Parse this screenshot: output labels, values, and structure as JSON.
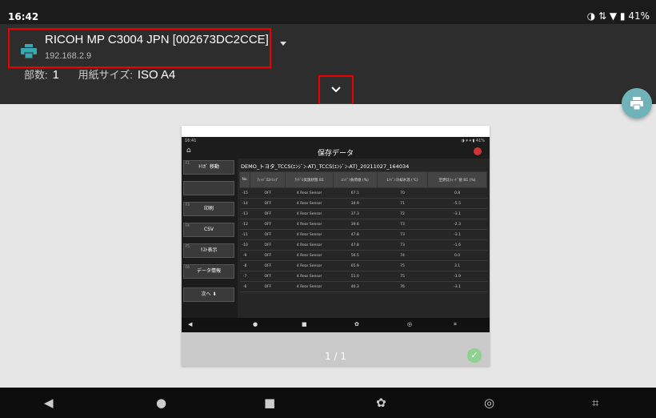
{
  "status": {
    "time": "16:42",
    "indicators": "◑ ⇅ ▼ ▮",
    "battery": "41%"
  },
  "printer": {
    "name": "RICOH MP C3004 JPN [002673DC2CCE]",
    "ip": "192.168.2.9"
  },
  "settings": {
    "copies_label": "部数:",
    "copies_value": "1",
    "paper_label": "用紙サイズ:",
    "paper_value": "ISO A4"
  },
  "preview": {
    "status_time": "16:41",
    "status_right": "◑ ▾ ▾ ▮ 41%",
    "title": "保存データ",
    "file_name": "DEMO_トヨタ_TCCS(ｴﾝｼﾞﾝ-AT)_TCCS(ｴﾝｼﾞﾝ-AT)_20211027_164034",
    "side_buttons": [
      {
        "fkey": "F1",
        "label": "ﾄﾘｶﾞ 移動"
      },
      {
        "fkey": "",
        "label": ""
      },
      {
        "fkey": "F3",
        "label": "印刷"
      },
      {
        "fkey": "F4",
        "label": "CSV"
      },
      {
        "fkey": "F5",
        "label": "ﾘｽﾄ表示"
      },
      {
        "fkey": "F6",
        "label": "データ情報"
      },
      {
        "fkey": "",
        "label": "次へ ⬇"
      }
    ],
    "columns": [
      "No.",
      "ｱｨｯﾄﾞﾛｽﾄﾘﾚﾌﾟ",
      "ｱｲﾄﾞﾙ実施状態 B1",
      "ｴﾝｼﾞﾝ負荷値 (%)",
      "ｴﾝｼﾞﾝ冷却水温 (℃)",
      "空燃比ﾌｨｰﾄﾞ値 B1 (%)"
    ],
    "rows": [
      [
        "-15",
        "OFF",
        "4 Rear Sensor",
        "67.1",
        "70",
        "0.8"
      ],
      [
        "-14",
        "OFF",
        "4 Rear Sensor",
        "34.9",
        "71",
        "-5.5"
      ],
      [
        "-13",
        "OFF",
        "4 Rear Sensor",
        "37.3",
        "72",
        "-3.1"
      ],
      [
        "-12",
        "OFF",
        "4 Rear Sensor",
        "39.6",
        "73",
        "-2.3"
      ],
      [
        "-11",
        "OFF",
        "4 Rear Sensor",
        "47.8",
        "73",
        "-3.1"
      ],
      [
        "-10",
        "OFF",
        "4 Rear Sensor",
        "47.8",
        "73",
        "-1.6"
      ],
      [
        "-9",
        "OFF",
        "4 Rear Sensor",
        "56.5",
        "74",
        "0.0"
      ],
      [
        "-8",
        "OFF",
        "4 Rear Sensor",
        "65.9",
        "75",
        "3.1"
      ],
      [
        "-7",
        "OFF",
        "4 Rear Sensor",
        "51.0",
        "75",
        "-3.9"
      ],
      [
        "-6",
        "OFF",
        "4 Rear Sensor",
        "46.3",
        "76",
        "-3.1"
      ]
    ],
    "nav": [
      "◀",
      "●",
      "■",
      "✿",
      "◎",
      "⌗"
    ],
    "page": "1 / 1"
  },
  "navbar": [
    "◀",
    "●",
    "■",
    "✿",
    "◎",
    "⌗"
  ]
}
